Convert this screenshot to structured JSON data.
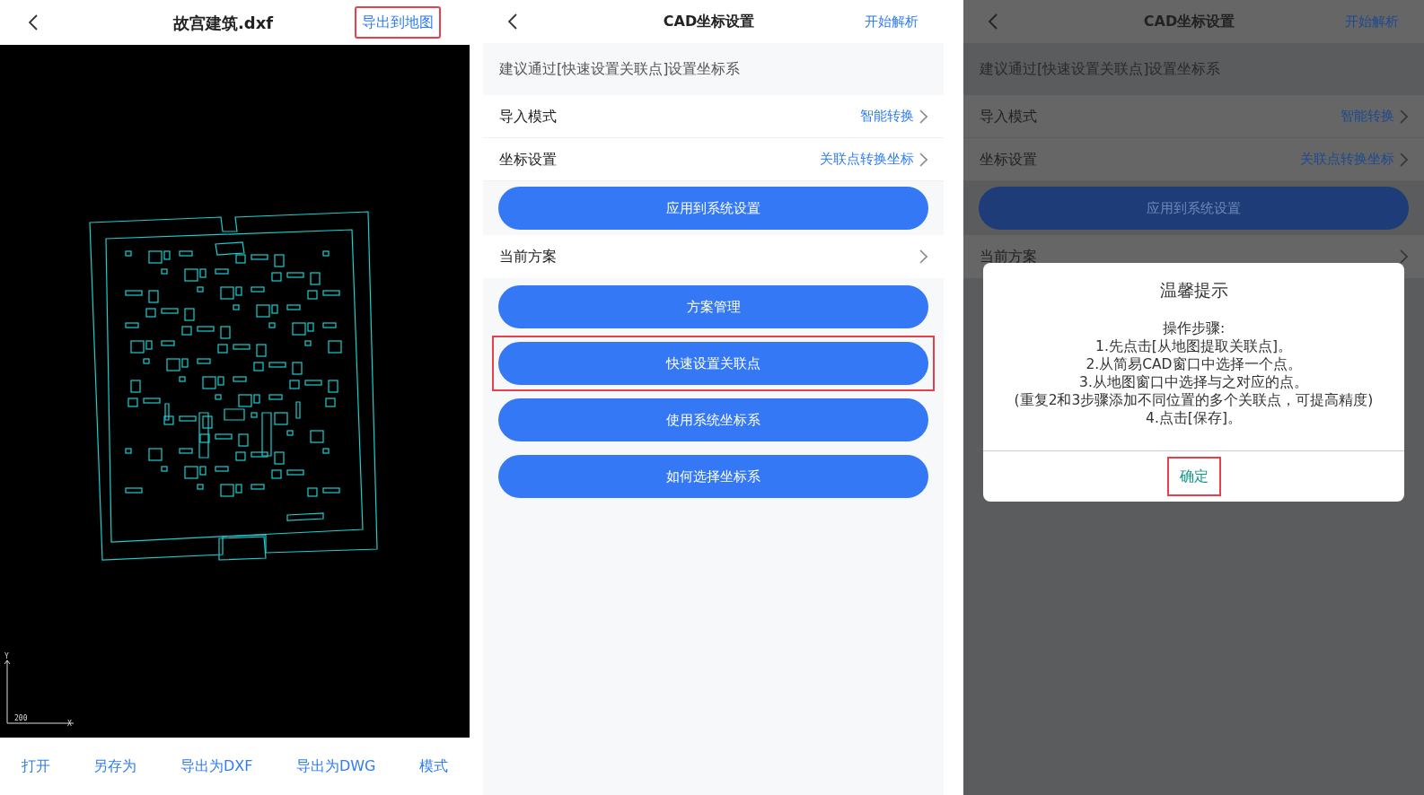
{
  "viewer": {
    "title": "故宫建筑.dxf",
    "action": {
      "label": "导出到地图",
      "highlighted": true
    },
    "axis": {
      "y_label": "Y",
      "x_label": "X",
      "scale": "200"
    },
    "toolbar": [
      {
        "label": "打开"
      },
      {
        "label": "另存为"
      },
      {
        "label": "导出为DXF"
      },
      {
        "label": "导出为DWG"
      },
      {
        "label": "模式"
      }
    ]
  },
  "settings": {
    "title": "CAD坐标设置",
    "action": "开始解析",
    "hint": "建议通过[快速设置关联点]设置坐标系",
    "rows": [
      {
        "label": "导入模式",
        "value": "智能转换"
      },
      {
        "label": "坐标设置",
        "value": "关联点转换坐标"
      }
    ],
    "apply_button": "应用到系统设置",
    "plan_row": "当前方案",
    "buttons": [
      {
        "label": "方案管理",
        "highlighted": false
      },
      {
        "label": "快速设置关联点",
        "highlighted": true
      },
      {
        "label": "使用系统坐标系",
        "highlighted": false
      },
      {
        "label": "如何选择坐标系",
        "highlighted": false
      }
    ]
  },
  "dialog_screen": {
    "title": "CAD坐标设置",
    "action": "开始解析",
    "hint": "建议通过[快速设置关联点]设置坐标系",
    "rows": [
      {
        "label": "导入模式",
        "value": "智能转换"
      },
      {
        "label": "坐标设置",
        "value": "关联点转换坐标"
      }
    ],
    "apply_button": "应用到系统设置",
    "plan_row": "当前方案",
    "dialog": {
      "title": "温馨提示",
      "lines": [
        "操作步骤:",
        "1.先点击[从地图提取关联点]。",
        "2.从简易CAD窗口中选择一个点。",
        "3.从地图窗口中选择与之对应的点。",
        "(重复2和3步骤添加不同位置的多个关联点，可提高精度)",
        "4.点击[保存]。"
      ],
      "confirm": {
        "label": "确定",
        "highlighted": true
      }
    }
  }
}
